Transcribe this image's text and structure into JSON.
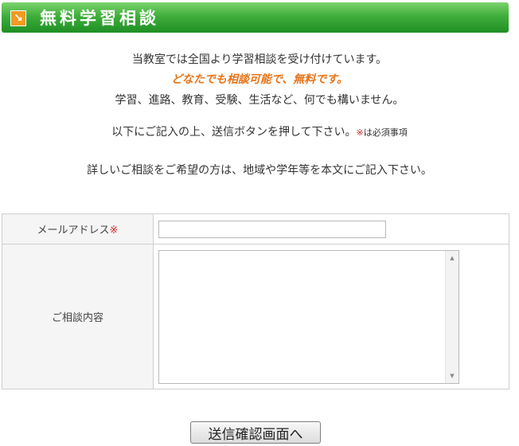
{
  "header": {
    "icon": "arrow-down-right-icon",
    "title": "無料学習相談"
  },
  "intro": {
    "line1": "当教室では全国より学習相談を受け付けています。",
    "line2": "どなたでも相談可能で、無料です。",
    "line3": "学習、進路、教育、受験、生活など、何でも構いません。",
    "line4_main": "以下にご記入の上、送信ボタンを押して下さい。",
    "line4_mark": "※",
    "line4_note": "は必須事項",
    "line5": "詳しいご相談をご希望の方は、地域や学年等を本文にご記入下さい。"
  },
  "form": {
    "email_label": "メールアドレス",
    "required_mark": "※",
    "email_value": "",
    "message_label": "ご相談内容",
    "message_value": ""
  },
  "submit_label": "送信確認画面へ",
  "colors": {
    "header_green": "#3fae3a",
    "accent_orange": "#e8741a",
    "required_red": "#d42a2a"
  }
}
